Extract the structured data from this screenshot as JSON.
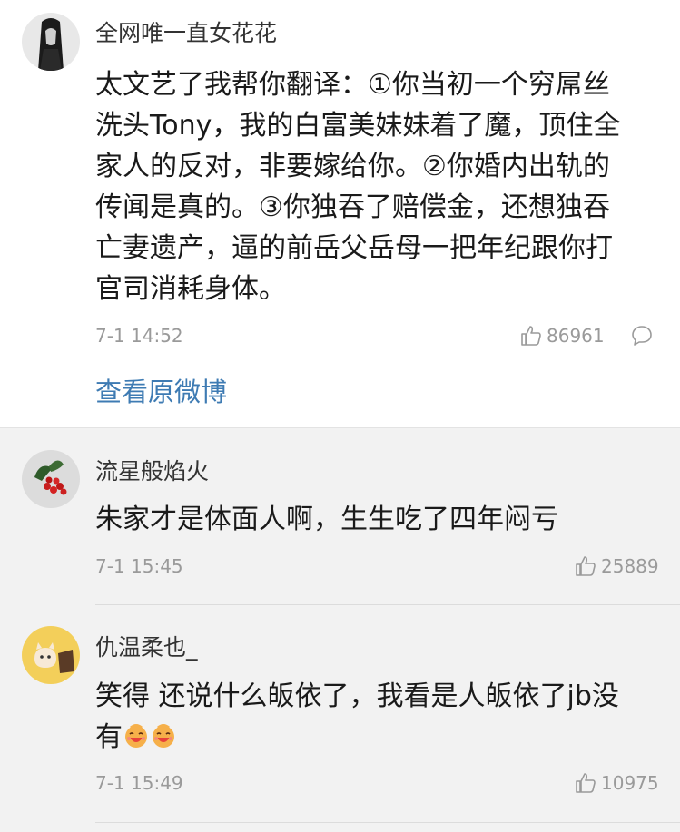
{
  "comments": [
    {
      "username": "全网唯一直女花花",
      "lines": [
        "太文艺了我帮你翻译：①你当初一个穷屌丝",
        "洗头Tony，我的白富美妹妹着了魔，顶住全",
        "家人的反对，非要嫁给你。②你婚内出轨的",
        "传闻是真的。③你独吞了赔偿金，还想独吞",
        "亡妻遗产，逼的前岳父岳母一把年纪跟你打",
        "官司消耗身体。"
      ],
      "time": "7-1 14:52",
      "likes": "86961",
      "view_original": "查看原微博"
    },
    {
      "username": "流星般焰火",
      "text": "朱家才是体面人啊，生生吃了四年闷亏",
      "time": "7-1 15:45",
      "likes": "25889"
    },
    {
      "username": "仇温柔也_",
      "line1": "笑得 还说什么皈依了，我看是人皈依了jb没",
      "line2": "有",
      "time": "7-1 15:49",
      "likes": "10975"
    }
  ],
  "icons": {
    "like": "thumbs-up-icon",
    "reply": "speech-bubble-icon",
    "emoji": "laughing-face-emoji"
  },
  "colors": {
    "link": "#3e7bb3",
    "meta": "#9a9a9a",
    "background": "#f2f2f2"
  }
}
